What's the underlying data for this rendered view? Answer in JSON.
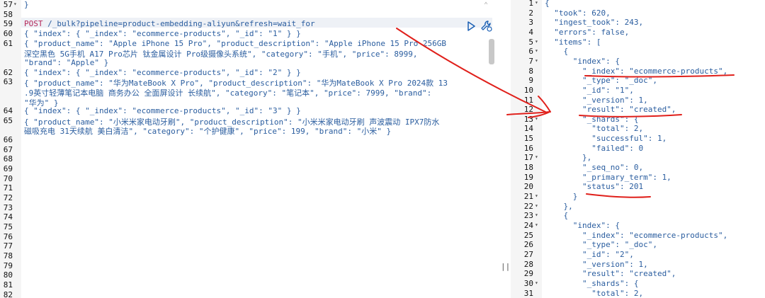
{
  "left_editor": {
    "lines": [
      {
        "n": "57",
        "fold": true,
        "text": "}"
      },
      {
        "n": "58",
        "text": ""
      },
      {
        "n": "59",
        "text": "POST /_bulk?pipeline=product-embedding-aliyun&refresh=wait_for"
      },
      {
        "n": "60",
        "text": "{ \"index\": { \"_index\": \"ecommerce-products\", \"_id\": \"1\" } }"
      },
      {
        "n": "61",
        "text": "{ \"product_name\": \"Apple iPhone 15 Pro\", \"product_description\": \"Apple iPhone 15 Pro 256GB"
      },
      {
        "n": "",
        "text": "深空黑色 5G手机 A17 Pro芯片 钛金属设计 Pro级摄像头系统\", \"category\": \"手机\", \"price\": 8999,"
      },
      {
        "n": "",
        "text": "\"brand\": \"Apple\" }"
      },
      {
        "n": "62",
        "text": "{ \"index\": { \"_index\": \"ecommerce-products\", \"_id\": \"2\" } }"
      },
      {
        "n": "63",
        "text": "{ \"product_name\": \"华为MateBook X Pro\", \"product_description\": \"华为MateBook X Pro 2024款 13"
      },
      {
        "n": "",
        "text": ".9英寸轻薄笔记本电脑 商务办公 全面屏设计 长续航\", \"category\": \"笔记本\", \"price\": 7999, \"brand\":"
      },
      {
        "n": "",
        "text": "\"华为\" }"
      },
      {
        "n": "64",
        "text": "{ \"index\": { \"_index\": \"ecommerce-products\", \"_id\": \"3\" } }"
      },
      {
        "n": "65",
        "text": "{ \"product_name\": \"小米米家电动牙刷\", \"product_description\": \"小米米家电动牙刷 声波震动 IPX7防水"
      },
      {
        "n": "",
        "text": "磁吸充电 31天续航 美白清洁\", \"category\": \"个护健康\", \"price\": 199, \"brand\": \"小米\" }"
      },
      {
        "n": "66",
        "text": ""
      },
      {
        "n": "67",
        "text": ""
      },
      {
        "n": "68",
        "text": ""
      },
      {
        "n": "69",
        "text": ""
      },
      {
        "n": "70",
        "text": ""
      },
      {
        "n": "71",
        "text": ""
      },
      {
        "n": "72",
        "text": ""
      },
      {
        "n": "73",
        "text": ""
      },
      {
        "n": "74",
        "text": ""
      },
      {
        "n": "75",
        "text": ""
      },
      {
        "n": "76",
        "text": ""
      },
      {
        "n": "77",
        "text": ""
      },
      {
        "n": "78",
        "text": ""
      },
      {
        "n": "79",
        "text": ""
      },
      {
        "n": "80",
        "text": ""
      },
      {
        "n": "81",
        "text": ""
      },
      {
        "n": "82",
        "text": ""
      }
    ]
  },
  "right_editor": {
    "lines": [
      {
        "n": "1",
        "fold": true,
        "text": "{"
      },
      {
        "n": "2",
        "text": "  \"took\": 620,"
      },
      {
        "n": "3",
        "text": "  \"ingest_took\": 243,"
      },
      {
        "n": "4",
        "text": "  \"errors\": false,"
      },
      {
        "n": "5",
        "fold": true,
        "text": "  \"items\": ["
      },
      {
        "n": "6",
        "fold": true,
        "text": "    {"
      },
      {
        "n": "7",
        "fold": true,
        "text": "      \"index\": {"
      },
      {
        "n": "8",
        "text": "        \"_index\": \"ecommerce-products\","
      },
      {
        "n": "9",
        "text": "        \"_type\": \"_doc\","
      },
      {
        "n": "10",
        "text": "        \"_id\": \"1\","
      },
      {
        "n": "11",
        "text": "        \"_version\": 1,"
      },
      {
        "n": "12",
        "text": "        \"result\": \"created\","
      },
      {
        "n": "13",
        "fold": true,
        "text": "        \"_shards\": {"
      },
      {
        "n": "14",
        "text": "          \"total\": 2,"
      },
      {
        "n": "15",
        "text": "          \"successful\": 1,"
      },
      {
        "n": "16",
        "text": "          \"failed\": 0"
      },
      {
        "n": "17",
        "fold": true,
        "text": "        },"
      },
      {
        "n": "18",
        "text": "        \"_seq_no\": 0,"
      },
      {
        "n": "19",
        "text": "        \"_primary_term\": 1,"
      },
      {
        "n": "20",
        "text": "        \"status\": 201"
      },
      {
        "n": "21",
        "fold": true,
        "text": "      }"
      },
      {
        "n": "22",
        "fold": true,
        "text": "    },"
      },
      {
        "n": "23",
        "fold": true,
        "text": "    {"
      },
      {
        "n": "24",
        "fold": true,
        "text": "      \"index\": {"
      },
      {
        "n": "25",
        "text": "        \"_index\": \"ecommerce-products\","
      },
      {
        "n": "26",
        "text": "        \"_type\": \"_doc\","
      },
      {
        "n": "27",
        "text": "        \"_id\": \"2\","
      },
      {
        "n": "28",
        "text": "        \"_version\": 1,"
      },
      {
        "n": "29",
        "text": "        \"result\": \"created\","
      },
      {
        "n": "30",
        "fold": true,
        "text": "        \"_shards\": {"
      },
      {
        "n": "31",
        "text": "          \"total\": 2,"
      }
    ]
  },
  "icons": {
    "run": "play-icon",
    "settings": "wrench-icon",
    "divider": "drag-handle-icon"
  },
  "colors": {
    "annotation": "#e0201b",
    "method": "#b5285a",
    "token": "#2a5d9f"
  }
}
